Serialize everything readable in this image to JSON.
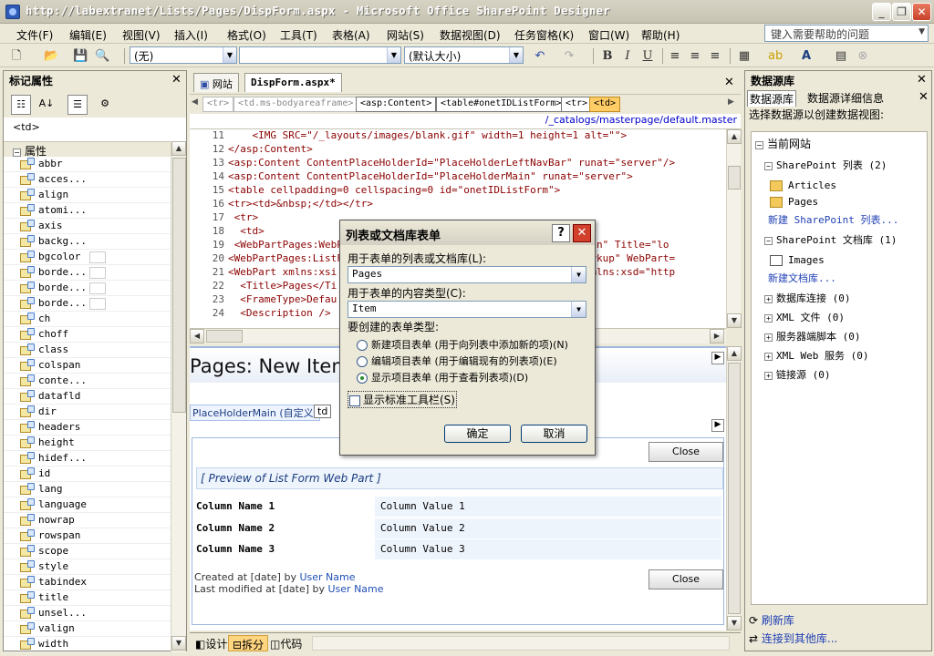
{
  "window": {
    "title": "http://labextranet/Lists/Pages/DispForm.aspx - Microsoft Office SharePoint Designer"
  },
  "menu": [
    "文件(F)",
    "编辑(E)",
    "视图(V)",
    "插入(I)",
    "格式(O)",
    "工具(T)",
    "表格(A)",
    "网站(S)",
    "数据视图(D)",
    "任务窗格(K)",
    "窗口(W)",
    "帮助(H)"
  ],
  "help_box": {
    "placeholder": "键入需要帮助的问题"
  },
  "toolbar": {
    "style": "(无)",
    "font": "",
    "size": "(默认大小)"
  },
  "left_panel": {
    "title": "标记属性",
    "td_label": "<td>",
    "attr_header": "属性",
    "attributes": [
      "abbr",
      "acces...",
      "align",
      "atomi...",
      "axis",
      "backg...",
      "bgcolor",
      "borde...",
      "borde...",
      "borde...",
      "ch",
      "choff",
      "class",
      "colspan",
      "conte...",
      "datafld",
      "dir",
      "headers",
      "height",
      "hidef...",
      "id",
      "lang",
      "language",
      "nowrap",
      "rowspan",
      "scope",
      "style",
      "tabindex",
      "title",
      "unsel...",
      "valign",
      "width"
    ]
  },
  "editor": {
    "tabs": [
      "网站",
      "DispForm.aspx*"
    ],
    "tags": [
      "<tr>",
      "<td.ms-bodyareaframe>",
      "<asp:Content>",
      "<table#onetIDListForm>",
      "<tr>",
      "<td>"
    ],
    "path": "/_catalogs/masterpage/default.master",
    "lines": [
      {
        "n": "11",
        "text": "    <IMG SRC=\"/_layouts/images/blank.gif\" width=1 height=1 alt=\"\">"
      },
      {
        "n": "12",
        "text": "</asp:Content>"
      },
      {
        "n": "13",
        "text": "<asp:Content ContentPlaceHolderId=\"PlaceHolderLeftNavBar\" runat=\"server\"/>"
      },
      {
        "n": "14",
        "text": "<asp:Content ContentPlaceHolderId=\"PlaceHolderMain\" runat=\"server\">"
      },
      {
        "n": "15",
        "text": "<table cellpadding=0 cellspacing=0 id=\"onetIDListForm\">"
      },
      {
        "n": "16",
        "text": "<tr><td>&nbsp;</td></tr>"
      },
      {
        "n": "17",
        "text": " <tr>"
      },
      {
        "n": "18",
        "text": "  <td>"
      },
      {
        "n": "19",
        "text": " <WebPartPages:WebPartZone                            ID=\"Main\" Title=\"lo"
      },
      {
        "n": "20",
        "text": "<WebPartPages:ListF                                  =\"xmlmarkup\" WebPart="
      },
      {
        "n": "21",
        "text": "<WebPart xmlns:xsi                                   ance\" xmlns:xsd=\"http"
      },
      {
        "n": "22",
        "text": "  <Title>Pages</Ti"
      },
      {
        "n": "23",
        "text": "  <FrameType>Defau"
      },
      {
        "n": "24",
        "text": "  <Description />"
      }
    ],
    "design": {
      "title": "Pages: New Item",
      "placeholder_label": "PlaceHolderMain (自定义)",
      "td_label": "td",
      "close": "Close",
      "preview": "[ Preview of List Form Web Part ]",
      "rows": [
        {
          "name": "Column Name 1",
          "value": "Column Value 1"
        },
        {
          "name": "Column Name 2",
          "value": "Column Value 2"
        },
        {
          "name": "Column Name 3",
          "value": "Column Value 3"
        }
      ],
      "created_prefix": "Created at [date] by ",
      "modified_prefix": "Last modified at [date] by ",
      "user": "User Name"
    },
    "view_tabs": [
      "设计",
      "拆分",
      "代码"
    ]
  },
  "right_panel": {
    "title": "数据源库",
    "tabs": [
      "数据源库",
      "数据源详细信息"
    ],
    "desc": "选择数据源以创建数据视图:",
    "current_site": "当前网站",
    "sp_lists": "SharePoint 列表 (2)",
    "articles": "Articles",
    "pages": "Pages",
    "new_list": "新建 SharePoint 列表...",
    "sp_libs": "SharePoint 文档库 (1)",
    "images": "Images",
    "new_lib": "新建文档库...",
    "others": [
      "数据库连接 (0)",
      "XML 文件 (0)",
      "服务器端脚本 (0)",
      "XML Web 服务 (0)",
      "链接源 (0)"
    ],
    "refresh": "刷新库",
    "connect": "连接到其他库..."
  },
  "dialog": {
    "title": "列表或文档库表单",
    "list_label": "用于表单的列表或文档库(L):",
    "list_value": "Pages",
    "ct_label": "用于表单的内容类型(C):",
    "ct_value": "Item",
    "type_label": "要创建的表单类型:",
    "options": [
      "新建项目表单 (用于向列表中添加新的项)(N)",
      "编辑项目表单 (用于编辑现有的列表项)(E)",
      "显示项目表单 (用于查看列表项)(D)"
    ],
    "selected": 2,
    "checkbox": "显示标准工具栏(S)",
    "ok": "确定",
    "cancel": "取消"
  }
}
